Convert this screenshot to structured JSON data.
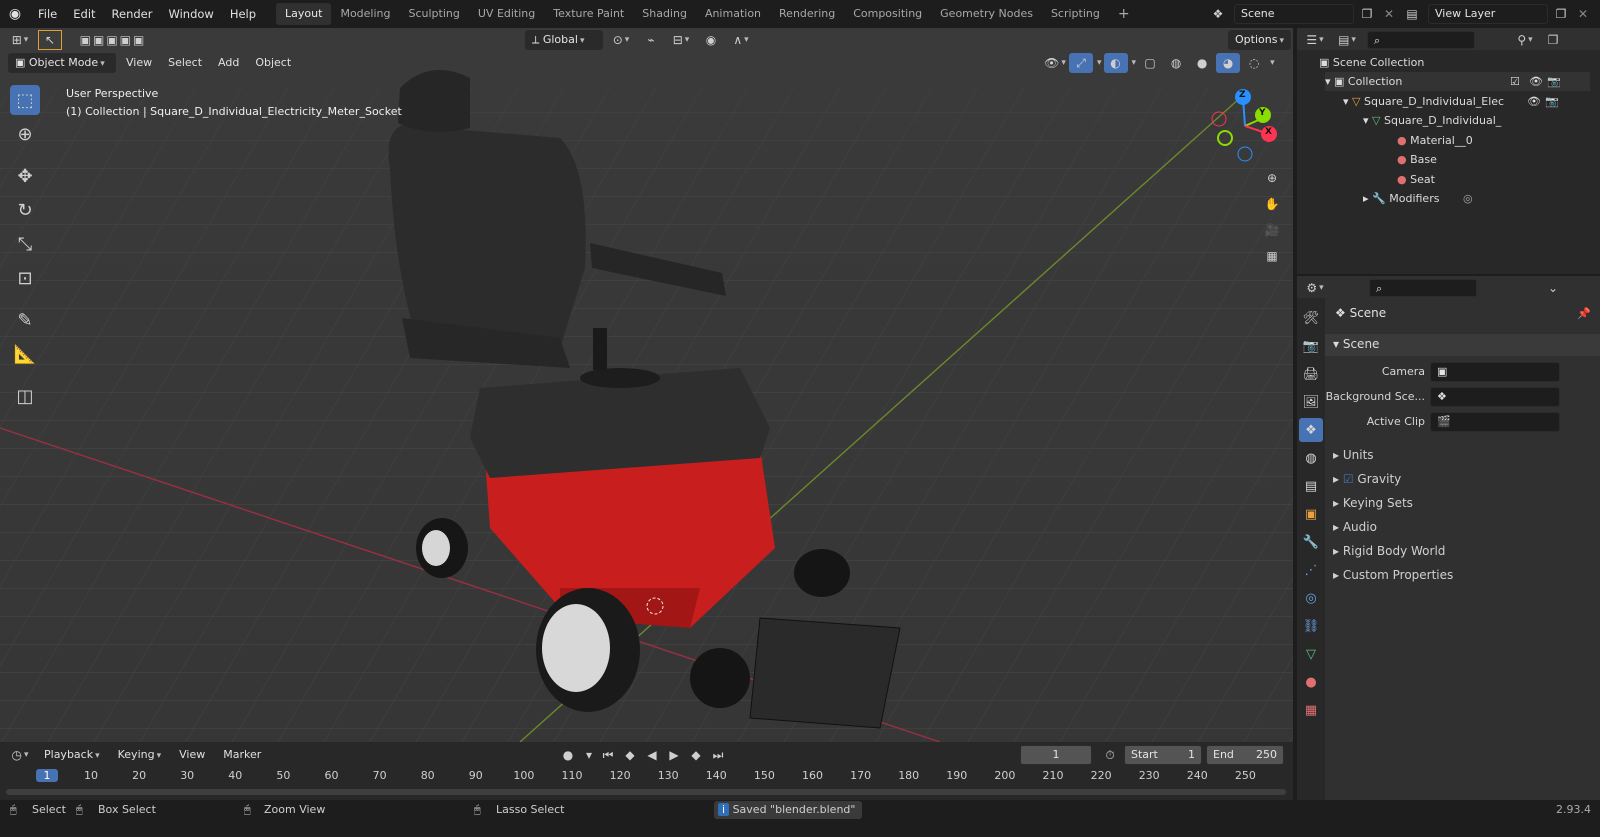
{
  "app": {
    "version": "2.93.4"
  },
  "topbar": {
    "menus": [
      "File",
      "Edit",
      "Render",
      "Window",
      "Help"
    ],
    "workspaces": [
      "Layout",
      "Modeling",
      "Sculpting",
      "UV Editing",
      "Texture Paint",
      "Shading",
      "Animation",
      "Rendering",
      "Compositing",
      "Geometry Nodes",
      "Scripting"
    ],
    "add_workspace": "+",
    "scene": "Scene",
    "view_layer": "View Layer"
  },
  "viewport": {
    "transform_orientation": "Global",
    "options_label": "Options",
    "mode": "Object Mode",
    "header_menus": [
      "View",
      "Select",
      "Add",
      "Object"
    ],
    "info_line1": "User Perspective",
    "info_line2": "(1) Collection | Square_D_Individual_Electricity_Meter_Socket",
    "gizmo": {
      "x": "X",
      "y": "Y",
      "z": "Z"
    }
  },
  "outliner": {
    "search_placeholder": "",
    "rows": [
      {
        "label": "Scene Collection"
      },
      {
        "label": "Collection"
      },
      {
        "label": "Square_D_Individual_Elec"
      },
      {
        "label": "Square_D_Individual_"
      },
      {
        "label": "Material__0"
      },
      {
        "label": "Base"
      },
      {
        "label": "Seat"
      },
      {
        "label": "Modifiers"
      }
    ]
  },
  "properties": {
    "title": "Scene",
    "section": "Scene",
    "fields": [
      {
        "label": "Camera",
        "value": ""
      },
      {
        "label": "Background Sce...",
        "value": ""
      },
      {
        "label": "Active Clip",
        "value": ""
      }
    ],
    "panels": [
      "Units",
      "Gravity",
      "Keying Sets",
      "Audio",
      "Rigid Body World",
      "Custom Properties"
    ],
    "gravity_checked": true
  },
  "timeline": {
    "menus": [
      "Playback",
      "Keying",
      "View",
      "Marker"
    ],
    "current_frame": "1",
    "start_label": "Start",
    "start": "1",
    "end_label": "End",
    "end": "250",
    "ticks": [
      "1",
      "10",
      "20",
      "30",
      "40",
      "50",
      "60",
      "70",
      "80",
      "90",
      "100",
      "110",
      "120",
      "130",
      "140",
      "150",
      "160",
      "170",
      "180",
      "190",
      "200",
      "210",
      "220",
      "230",
      "240",
      "250"
    ]
  },
  "statusbar": {
    "select": "Select",
    "box_select": "Box Select",
    "zoom_view": "Zoom View",
    "lasso_select": "Lasso Select",
    "message": "Saved \"blender.blend\"",
    "version": "2.93.4"
  },
  "colors": {
    "accent": "#4772b3",
    "x_axis": "#ff3352",
    "y_axis": "#8bdc00",
    "z_axis": "#2890ff",
    "chair_red": "#c81e1e"
  }
}
